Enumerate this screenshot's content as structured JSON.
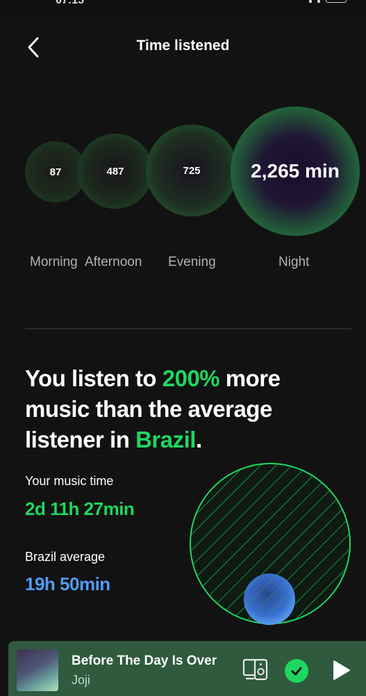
{
  "status_bar": {
    "time": "07:15"
  },
  "header": {
    "back_icon": "chevron-left-icon",
    "title": "Time listened"
  },
  "time_of_day": [
    {
      "label": "Morning",
      "value": "87"
    },
    {
      "label": "Afternoon",
      "value": "487"
    },
    {
      "label": "Evening",
      "value": "725"
    },
    {
      "label": "Night",
      "value": "2,265 min"
    }
  ],
  "comparison": {
    "headline_part1": "You listen to ",
    "headline_percent": "200%",
    "headline_part2": " more music than the average listener in ",
    "headline_country": "Brazil",
    "headline_end": ".",
    "your_label": "Your music time",
    "your_value": "2d 11h 27min",
    "avg_label": "Brazil average",
    "avg_value": "19h 50min"
  },
  "now_playing": {
    "title": "Before The Day Is Over",
    "artist": "Joji",
    "devices_icon": "connect-devices-icon",
    "saved_icon": "check-circle-icon",
    "play_icon": "play-icon"
  },
  "colors": {
    "accent_green": "#1ed760",
    "accent_blue": "#509bf5",
    "background": "#121212",
    "player_bg": "#2f5a3e"
  }
}
